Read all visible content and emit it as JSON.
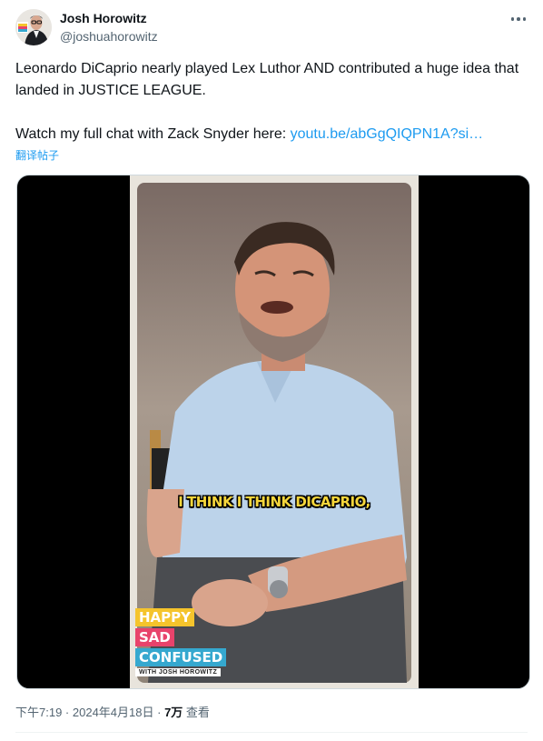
{
  "author": {
    "name": "Josh Horowitz",
    "handle": "@joshuahorowitz",
    "avatar_icon": "avatar-photo"
  },
  "more_icon": "ellipsis-icon",
  "tweet": {
    "text_line1": "Leonardo DiCaprio nearly played Lex Luthor AND contributed a huge idea that landed in JUSTICE LEAGUE.",
    "text_line2_prefix": "Watch my full chat with Zack Snyder here: ",
    "link_text": "youtu.be/abGgQIQPN1A?si…",
    "translate_label": "翻译帖子"
  },
  "video": {
    "caption": "I THINK I THINK DICAPRIO,",
    "logo": {
      "happy": "HAPPY",
      "sad": "SAD",
      "confused": "CONFUSED",
      "with": "WITH JOSH HOROWITZ"
    }
  },
  "meta": {
    "time": "下午7:19",
    "separator1": " · ",
    "date": "2024年4月18日",
    "separator2": " · ",
    "views_count": "7万",
    "views_label": " 查看"
  },
  "colors": {
    "link": "#1d9bf0",
    "secondary_text": "#536471",
    "caption_yellow": "#f5d63b",
    "logo_yellow": "#f5c42c",
    "logo_pink": "#e8436b",
    "logo_blue": "#35a8cf"
  }
}
